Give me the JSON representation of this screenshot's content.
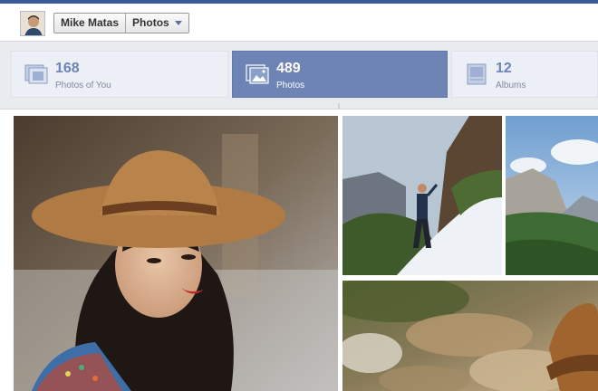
{
  "header": {
    "user_name": "Mike Matas",
    "section": "Photos"
  },
  "tabs": [
    {
      "count": "168",
      "label": "Photos of You",
      "icon": "photos-of-you-icon",
      "active": false
    },
    {
      "count": "489",
      "label": "Photos",
      "icon": "photos-icon",
      "active": true
    },
    {
      "count": "12",
      "label": "Albums",
      "icon": "albums-icon",
      "active": false
    }
  ],
  "colors": {
    "brand": "#3b5998",
    "active_tab": "#6d84b4",
    "inactive_tab": "#eceff6"
  }
}
